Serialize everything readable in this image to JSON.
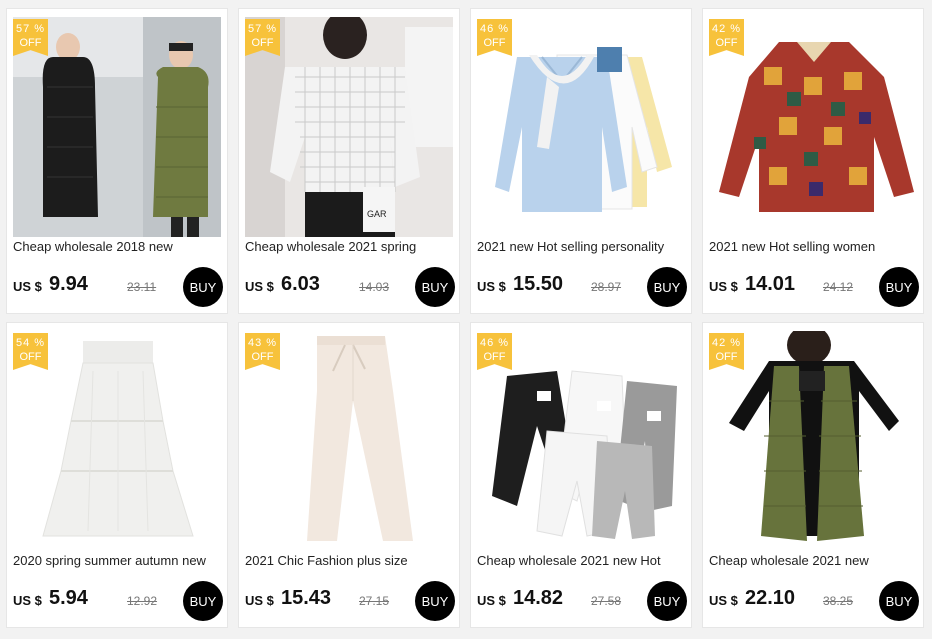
{
  "currency": "US $",
  "buy_label": "BUY",
  "off_label": "OFF",
  "products": [
    {
      "discount": "57 %",
      "title": "Cheap wholesale 2018 new",
      "price": "9.94",
      "old_price": "23.11"
    },
    {
      "discount": "57 %",
      "title": "Cheap wholesale 2021 spring",
      "price": "6.03",
      "old_price": "14.03"
    },
    {
      "discount": "46 %",
      "title": "2021 new Hot selling personality",
      "price": "15.50",
      "old_price": "28.97"
    },
    {
      "discount": "42 %",
      "title": "2021 new Hot selling women",
      "price": "14.01",
      "old_price": "24.12"
    },
    {
      "discount": "54 %",
      "title": "2020 spring summer autumn new",
      "price": "5.94",
      "old_price": "12.92"
    },
    {
      "discount": "43 %",
      "title": "2021 Chic Fashion plus size",
      "price": "15.43",
      "old_price": "27.15"
    },
    {
      "discount": "46 %",
      "title": "Cheap wholesale 2021 new Hot",
      "price": "14.82",
      "old_price": "27.58"
    },
    {
      "discount": "42 %",
      "title": "Cheap wholesale 2021 new",
      "price": "22.10",
      "old_price": "38.25"
    }
  ],
  "colors": {
    "badge": "#f7c23b",
    "buy_button": "#000000",
    "background": "#f2f2f2"
  }
}
